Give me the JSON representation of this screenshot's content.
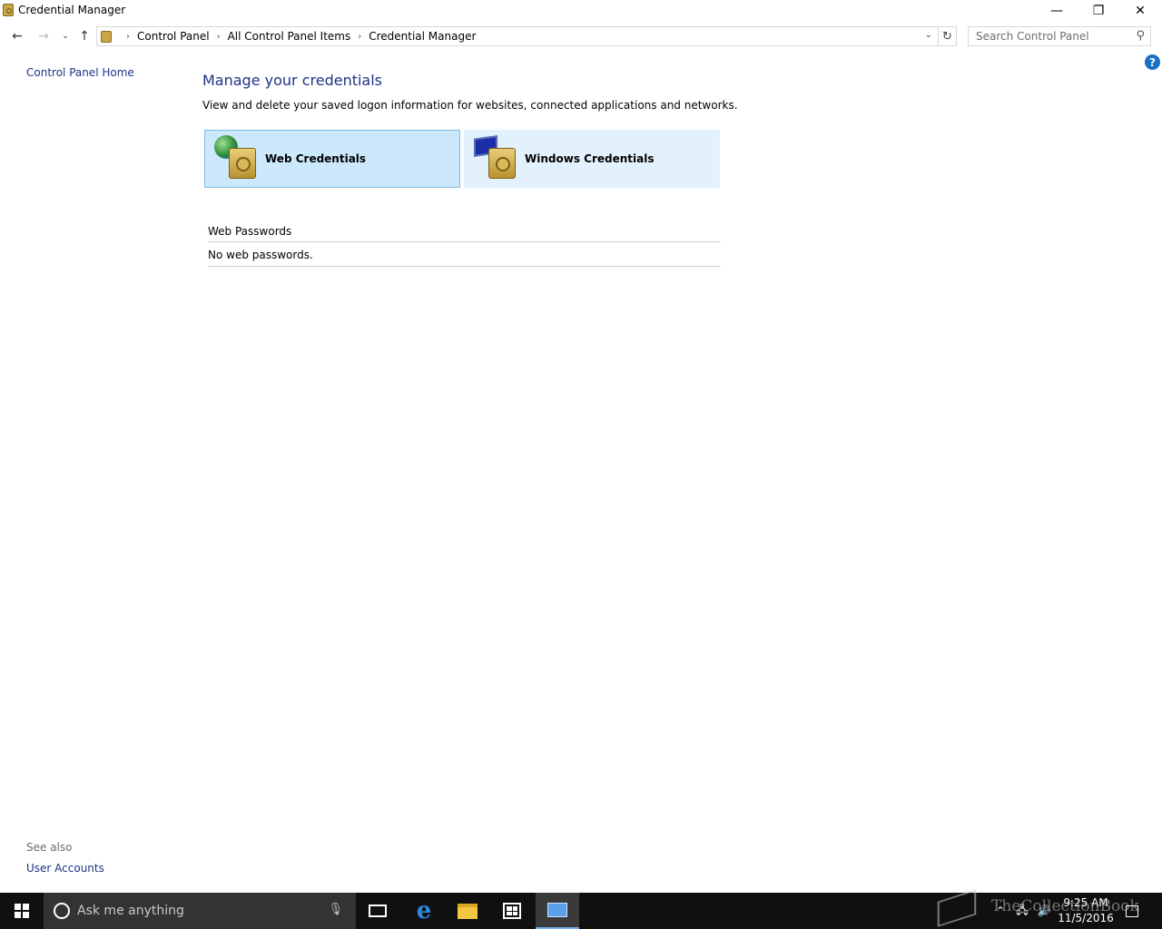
{
  "window": {
    "title": "Credential Manager",
    "minimize_glyph": "—",
    "maximize_glyph": "❐",
    "close_glyph": "✕"
  },
  "nav": {
    "back_glyph": "←",
    "forward_glyph": "→",
    "recent_glyph": "⌄",
    "up_glyph": "↑",
    "breadcrumbs": [
      "Control Panel",
      "All Control Panel Items",
      "Credential Manager"
    ],
    "separator_glyph": "›",
    "dropdown_glyph": "⌄",
    "refresh_glyph": "↻",
    "search_placeholder": "Search Control Panel",
    "search_glyph": "⚲"
  },
  "help_glyph": "?",
  "left_pane": {
    "home_link": "Control Panel Home",
    "see_also_label": "See also",
    "see_also_links": [
      "User Accounts"
    ]
  },
  "main": {
    "heading": "Manage your credentials",
    "description": "View and delete your saved logon information for websites, connected applications and networks.",
    "credential_types": [
      {
        "label": "Web Credentials",
        "selected": true,
        "icon": "globe-vault-icon"
      },
      {
        "label": "Windows Credentials",
        "selected": false,
        "icon": "computer-vault-icon"
      }
    ],
    "web_passwords": {
      "title": "Web Passwords",
      "empty_message": "No web passwords."
    }
  },
  "taskbar": {
    "search_placeholder": "Ask me anything",
    "mic_glyph": "🎙",
    "edge_glyph": "e",
    "tray_chevron_glyph": "⌃",
    "network_glyph": "🖧",
    "volume_glyph": "🔊",
    "time": "9:25 AM",
    "date": "11/5/2016"
  },
  "watermark": {
    "text": "TheCollectionBook"
  },
  "colors": {
    "link": "#1e3287",
    "selected_tile": "#cce8fb",
    "unselected_tile": "#e3f1fc",
    "taskbar": "#101010",
    "cortana_box": "#333333"
  }
}
